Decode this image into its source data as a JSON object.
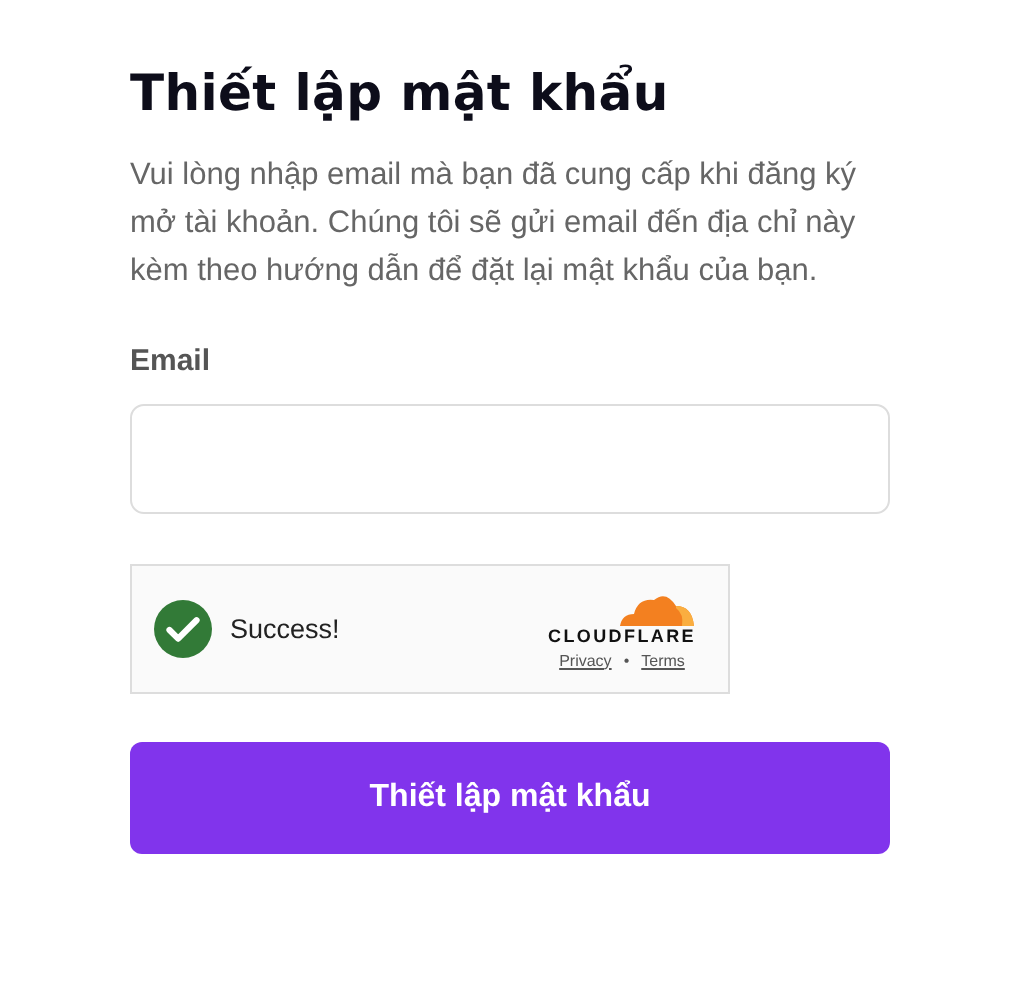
{
  "title": "Thiết lập mật khẩu",
  "description": "Vui lòng nhập email mà bạn đã cung cấp khi đăng ký mở tài khoản. Chúng tôi sẽ gửi email đến địa chỉ này kèm theo hướng dẫn để đặt lại mật khẩu của bạn.",
  "email_field": {
    "label": "Email"
  },
  "captcha": {
    "verified": true,
    "status_text": "Success!",
    "brand": "CLOUDFLARE",
    "links": [
      "Privacy",
      "Terms"
    ],
    "separator": "•"
  },
  "submit_button": "Thiết lập mật khẩu"
}
